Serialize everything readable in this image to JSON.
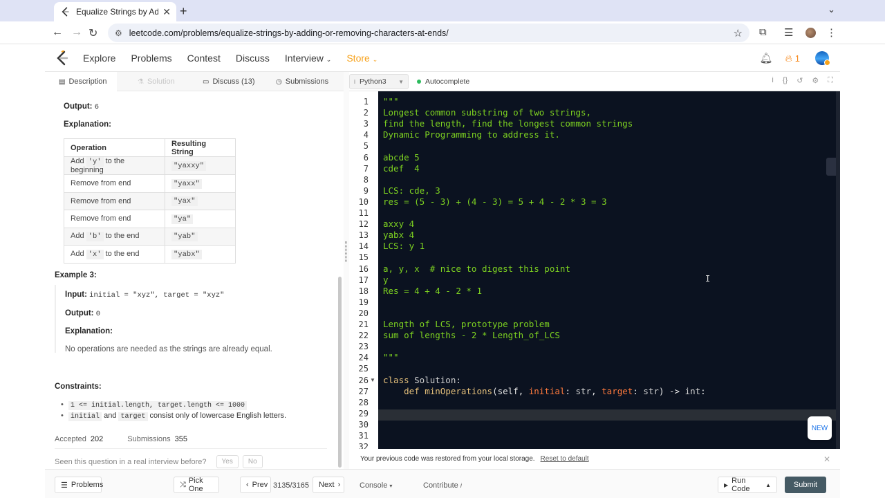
{
  "browser": {
    "tab_title": "Equalize Strings by Adding or Removing Characters at Ends",
    "url": "leetcode.com/problems/equalize-strings-by-adding-or-removing-characters-at-ends/"
  },
  "nav": {
    "items": [
      "Explore",
      "Problems",
      "Contest",
      "Discuss",
      "Interview",
      "Store"
    ],
    "streak": "1"
  },
  "left_tabs": [
    {
      "label": "Description"
    },
    {
      "label": "Solution"
    },
    {
      "label": "Discuss (13)"
    },
    {
      "label": "Submissions"
    }
  ],
  "example2": {
    "output_label": "Output:",
    "output_value": "6",
    "explanation_label": "Explanation:",
    "table_headers": [
      "Operation",
      "Resulting String"
    ],
    "rows": [
      {
        "pre": "Add ",
        "code": "'y'",
        "post": " to the beginning",
        "result": "\"yaxxy\""
      },
      {
        "pre": "Remove from end",
        "code": "",
        "post": "",
        "result": "\"yaxx\""
      },
      {
        "pre": "Remove from end",
        "code": "",
        "post": "",
        "result": "\"yax\""
      },
      {
        "pre": "Remove from end",
        "code": "",
        "post": "",
        "result": "\"ya\""
      },
      {
        "pre": "Add ",
        "code": "'b'",
        "post": " to the end",
        "result": "\"yab\""
      },
      {
        "pre": "Add ",
        "code": "'x'",
        "post": " to the end",
        "result": "\"yabx\""
      }
    ]
  },
  "example3": {
    "title": "Example 3:",
    "input_label": "Input:",
    "input_value": "initial = \"xyz\", target = \"xyz\"",
    "output_label": "Output:",
    "output_value": "0",
    "explanation_label": "Explanation:",
    "explanation": "No operations are needed as the strings are already equal."
  },
  "constraints": {
    "title": "Constraints:",
    "c1": "1 <= initial.length, target.length <= 1000",
    "c2_code1": "initial",
    "c2_mid": " and ",
    "c2_code2": "target",
    "c2_tail": " consist only of lowercase English letters."
  },
  "stats": {
    "accepted_label": "Accepted",
    "accepted": "202",
    "submissions_label": "Submissions",
    "submissions": "355"
  },
  "seen": {
    "question": "Seen this question in a real interview before?",
    "yes": "Yes",
    "no": "No"
  },
  "editor": {
    "language": "Python3",
    "autocomplete": "Autocomplete",
    "lines": [
      "\"\"\"",
      "Longest common substring of two strings,",
      "find the length, find the longest common strings",
      "Dynamic Programming to address it.",
      "",
      "abcde 5",
      "cdef  4",
      "",
      "LCS: cde, 3",
      "res = (5 - 3) + (4 - 3) = 5 + 4 - 2 * 3 = 3",
      "",
      "axxy 4",
      "yabx 4",
      "LCS: y 1",
      "",
      "a, y, x  # nice to digest this point",
      "y",
      "Res = 4 + 4 - 2 * 1",
      "",
      "",
      "Length of LCS, prototype problem",
      "sum of lengths - 2 * Length_of_LCS",
      "",
      "\"\"\"",
      "",
      "class Solution:",
      "    def minOperations(self, initial: str, target: str) -> int:",
      "",
      "",
      "",
      "",
      ""
    ],
    "new_badge": "NEW",
    "restore_msg": "Your previous code was restored from your local storage.",
    "reset_link": "Reset to default"
  },
  "bottom": {
    "problems": "Problems",
    "pick_one": "Pick One",
    "prev": "Prev",
    "count": "3135/3165",
    "next": "Next",
    "console": "Console",
    "contribute": "Contribute",
    "run_code": "Run Code",
    "submit": "Submit"
  }
}
